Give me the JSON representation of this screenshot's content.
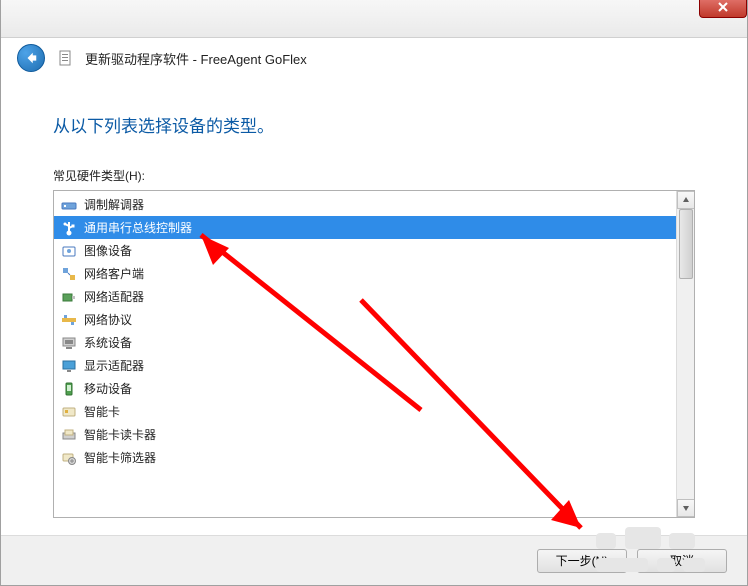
{
  "window": {
    "title": "更新驱动程序软件 - FreeAgent GoFlex"
  },
  "content": {
    "heading": "从以下列表选择设备的类型。",
    "list_label": "常见硬件类型(H):"
  },
  "list": {
    "selected_index": 1,
    "items": [
      {
        "icon": "modem-icon",
        "label": "调制解调器"
      },
      {
        "icon": "usb-icon",
        "label": "通用串行总线控制器"
      },
      {
        "icon": "image-device-icon",
        "label": "图像设备"
      },
      {
        "icon": "network-client-icon",
        "label": "网络客户端"
      },
      {
        "icon": "network-adapter-icon",
        "label": "网络适配器"
      },
      {
        "icon": "network-protocol-icon",
        "label": "网络协议"
      },
      {
        "icon": "system-device-icon",
        "label": "系统设备"
      },
      {
        "icon": "display-adapter-icon",
        "label": "显示适配器"
      },
      {
        "icon": "mobile-device-icon",
        "label": "移动设备"
      },
      {
        "icon": "smartcard-icon",
        "label": "智能卡"
      },
      {
        "icon": "smartcard-reader-icon",
        "label": "智能卡读卡器"
      },
      {
        "icon": "smartcard-filter-icon",
        "label": "智能卡筛选器"
      }
    ]
  },
  "footer": {
    "next_label": "下一步(N)",
    "cancel_label": "取消"
  }
}
